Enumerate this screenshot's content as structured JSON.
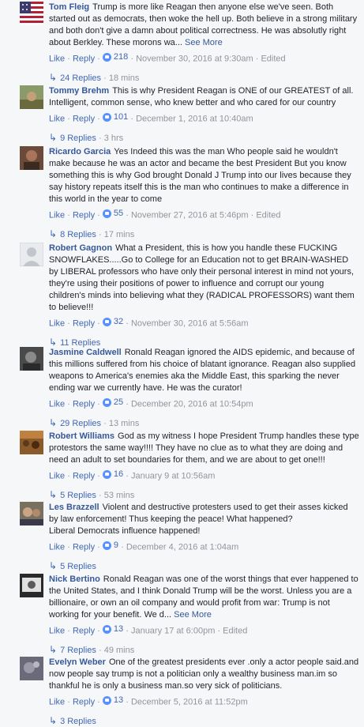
{
  "ui": {
    "like_label": "Like",
    "reply_label": "Reply",
    "edited_label": "Edited",
    "see_more_label": "See More",
    "separator": "·",
    "reply_arrow": "↳"
  },
  "comments": [
    {
      "author": "Tom Fleig",
      "text": "Trump is more like Reagan then anyone else we've seen. Both started out as democrats, then woke the hell up. Both believe in a strong military and both don't give a damn about political correctness. He was absolutly right about Berkley. These morons wa...",
      "see_more": true,
      "likes": "218",
      "timestamp": "November 30, 2016 at 9:30am",
      "edited": true,
      "replies": "24 Replies",
      "reply_time": "18 mins"
    },
    {
      "author": "Tommy Brehm",
      "text": "This is why President Reagan is ONE of our GREATEST of all. Intelligent, common sense, who knew better and who cared for our country",
      "see_more": false,
      "likes": "101",
      "timestamp": "December 1, 2016 at 10:40am",
      "edited": false,
      "replies": "9 Replies",
      "reply_time": "3 hrs"
    },
    {
      "author": "Ricardo Garcia",
      "text": "Yes Indeed this was the man Who people said he wouldn't make because he was an actor and became the best President But you know something this is why God brought Donald J Trump into our lives because they say history repeats itself this is the man who continues to make a difference in this world in the year to come",
      "see_more": false,
      "likes": "55",
      "timestamp": "November 27, 2016 at 5:46pm",
      "edited": true,
      "replies": "8 Replies",
      "reply_time": "17 mins"
    },
    {
      "author": "Robert Gagnon",
      "text": "What a President, this is how you handle these FUCKING SNOWFLAKES.....Go to College for an Education not to get BRAIN-WASHED by LIBERAL professors who have only their personal interest in mind not yours, they're using their positions of power to influence and corrupt our young children's minds into believing what they (RADICAL PROFESSORS) want them to believe!!!",
      "see_more": false,
      "likes": "32",
      "timestamp": "November 30, 2016 at 5:56am",
      "edited": false,
      "replies": "11 Replies",
      "reply_time": ""
    },
    {
      "author": "Jasmine Caldwell",
      "text": "Ronald Reagan ignored the AIDS epidemic, and because of this millions suffered from his choice of blatant ignorance. Reagan also supplied weapons to America's enemies aka the Middle East, this sparking the never ending war we currently have. He was the curator!",
      "see_more": false,
      "likes": "25",
      "timestamp": "December 20, 2016 at 10:54pm",
      "edited": false,
      "replies": "29 Replies",
      "reply_time": "13 mins"
    },
    {
      "author": "Robert Williams",
      "text": "God as my witness I hope President Trump handles these type protestors the same way!!!! They have no clue as to what they are doing and need an adult to set boundaries for them, and we are about to get one!!!",
      "see_more": false,
      "likes": "16",
      "timestamp": "January 9 at 10:56am",
      "edited": false,
      "replies": "5 Replies",
      "reply_time": "53 mins"
    },
    {
      "author": "Les Brazzell",
      "text": "Violent and destructive protesters used to get their asses kicked by law enforcement! Thus keeping the peace! What happened?\nLiberal Democrats influence happened!",
      "see_more": false,
      "likes": "9",
      "timestamp": "December 4, 2016 at 1:04am",
      "edited": false,
      "replies": "5 Replies",
      "reply_time": ""
    },
    {
      "author": "Nick Bertino",
      "text": "Ronald Reagan was one of the worst things that ever happened to the United States, and I think Donald Trump will be the worst. Unless you are a billionaire, or own an oil company and would profit from war: Trump is not working for your benefit. We d...",
      "see_more": true,
      "likes": "13",
      "timestamp": "January 17 at 6:00pm",
      "edited": true,
      "replies": "7 Replies",
      "reply_time": "49 mins"
    },
    {
      "author": "Evelyn Weber",
      "text": "One of the greatest presidents ever .only a actor people said.and now people say trump is not a politician only a wealthy business man.im so thankful he is only a business man.so very sick of politicians.",
      "see_more": false,
      "likes": "13",
      "timestamp": "December 5, 2016 at 11:52pm",
      "edited": false,
      "replies": "3 Replies",
      "reply_time": ""
    }
  ]
}
